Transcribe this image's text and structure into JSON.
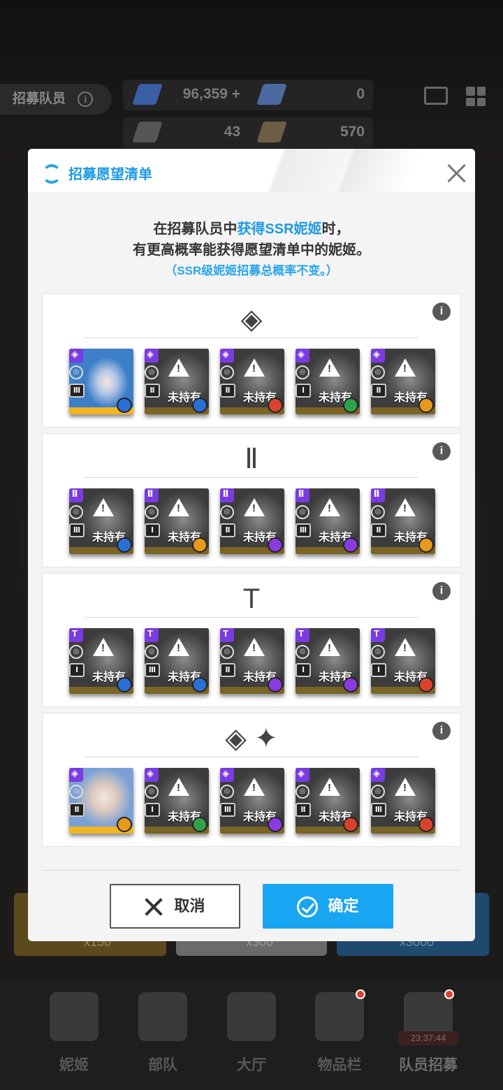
{
  "background": {
    "topbar": {
      "title": "招募队员",
      "info_glyph": "i",
      "currency": [
        {
          "value": "96,359",
          "plus": "+",
          "icon": "gem-icon"
        },
        {
          "value": "0",
          "icon": "ticket-icon"
        },
        {
          "value": "43",
          "icon": "recruit-ticket-icon"
        },
        {
          "value": "570",
          "icon": "voucher-icon"
        }
      ]
    },
    "bottom_nav": [
      {
        "label": "妮姬",
        "icon": "nikke-icon"
      },
      {
        "label": "部队",
        "icon": "squad-icon"
      },
      {
        "label": "大厅",
        "icon": "lobby-icon"
      },
      {
        "label": "物品栏",
        "icon": "inventory-icon"
      },
      {
        "label": "队员招募",
        "icon": "recruit-icon"
      }
    ],
    "timer": "23:37:44",
    "bottom_cards": [
      "x150",
      "x300",
      "x3000"
    ],
    "side_left": "《",
    "side_right": "》"
  },
  "modal": {
    "title": "招募愿望清单",
    "desc_line1_a": "在招募队员中",
    "desc_line1_hl": "获得SSR妮姬",
    "desc_line1_b": "时，",
    "desc_line2": "有更高概率能获得愿望清单中的妮姬。",
    "desc_line3": "（SSR级妮姬招募总概率不变。）",
    "sections": [
      {
        "icon": "◈",
        "icon_name": "elysion-icon",
        "cards": [
          {
            "owned": true,
            "status": "",
            "mfg": "◈",
            "burst": "Ⅲ",
            "element": "#2a6fd6"
          },
          {
            "owned": false,
            "status": "未持有",
            "mfg": "◈",
            "burst": "Ⅱ",
            "element": "#2a6fd6"
          },
          {
            "owned": false,
            "status": "未持有",
            "mfg": "◈",
            "burst": "Ⅱ",
            "element": "#d8432d"
          },
          {
            "owned": false,
            "status": "未持有",
            "mfg": "◈",
            "burst": "Ⅰ",
            "element": "#2fa24a"
          },
          {
            "owned": false,
            "status": "未持有",
            "mfg": "◈",
            "burst": "Ⅱ",
            "element": "#e89a1c"
          }
        ]
      },
      {
        "icon": "Ⅱ",
        "icon_name": "missilis-icon",
        "cards": [
          {
            "owned": false,
            "status": "未持有",
            "mfg": "Ⅱ",
            "burst": "Ⅲ",
            "element": "#2a6fd6"
          },
          {
            "owned": false,
            "status": "未持有",
            "mfg": "Ⅱ",
            "burst": "Ⅰ",
            "element": "#e89a1c"
          },
          {
            "owned": false,
            "status": "未持有",
            "mfg": "Ⅱ",
            "burst": "Ⅱ",
            "element": "#8a3be0"
          },
          {
            "owned": false,
            "status": "未持有",
            "mfg": "Ⅱ",
            "burst": "Ⅲ",
            "element": "#8a3be0"
          },
          {
            "owned": false,
            "status": "未持有",
            "mfg": "Ⅱ",
            "burst": "Ⅱ",
            "element": "#e89a1c"
          }
        ]
      },
      {
        "icon": "T",
        "icon_name": "tetra-icon",
        "cards": [
          {
            "owned": false,
            "status": "未持有",
            "mfg": "T",
            "burst": "Ⅰ",
            "element": "#2a6fd6"
          },
          {
            "owned": false,
            "status": "未持有",
            "mfg": "T",
            "burst": "Ⅲ",
            "element": "#2a6fd6"
          },
          {
            "owned": false,
            "status": "未持有",
            "mfg": "T",
            "burst": "Ⅱ",
            "element": "#8a3be0"
          },
          {
            "owned": false,
            "status": "未持有",
            "mfg": "T",
            "burst": "Ⅰ",
            "element": "#8a3be0"
          },
          {
            "owned": false,
            "status": "未持有",
            "mfg": "T",
            "burst": "Ⅰ",
            "element": "#d8432d"
          }
        ]
      },
      {
        "icon": "◈ ✦",
        "icon_name": "pilgrim-abnormal-icon",
        "cards": [
          {
            "owned": true,
            "status": "",
            "mfg": "◈",
            "burst": "Ⅱ",
            "element": "#e89a1c"
          },
          {
            "owned": false,
            "status": "未持有",
            "mfg": "◈",
            "burst": "Ⅰ",
            "element": "#2fa24a"
          },
          {
            "owned": false,
            "status": "未持有",
            "mfg": "◈",
            "burst": "Ⅲ",
            "element": "#8a3be0"
          },
          {
            "owned": false,
            "status": "未持有",
            "mfg": "◈",
            "burst": "Ⅱ",
            "element": "#d8432d"
          },
          {
            "owned": false,
            "status": "未持有",
            "mfg": "◈",
            "burst": "Ⅲ",
            "element": "#d8432d"
          }
        ]
      }
    ],
    "cancel_label": "取消",
    "confirm_label": "确定",
    "accent": "#18a6f2"
  }
}
